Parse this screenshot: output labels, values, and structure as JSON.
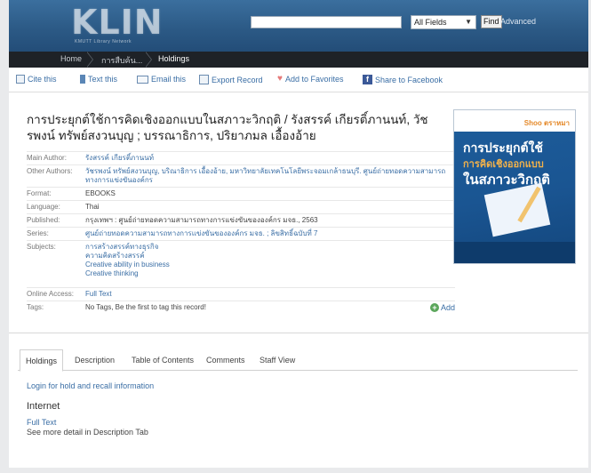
{
  "header": {
    "logo": "KLIN",
    "logo_sub": "KMUTT Library Network",
    "search_placeholder": "",
    "search_type": "All Fields",
    "find_label": "Find",
    "advanced_label": "Advanced"
  },
  "breadcrumb": [
    "Home",
    "การสืบค้น...",
    "Holdings"
  ],
  "toolbar": {
    "cite": "Cite this",
    "text": "Text this",
    "email": "Email this",
    "export": "Export Record",
    "favorites": "Add to Favorites",
    "facebook": "Share to Facebook"
  },
  "record": {
    "title": "การประยุกต์ใช้การคิดเชิงออกแบบในสภาวะวิกฤติ / รังสรรค์ เกียรติ์ภานนท์, วัชรพงน์ ทรัพย์สงวนบุญ ; บรรณาธิการ, ปริยาภมล เอื้องอ้าย",
    "rows": {
      "main_author_label": "Main Author:",
      "main_author": "รังสรรค์ เกียรติ์ภานนท์",
      "other_authors_label": "Other Authors:",
      "other_authors_1": "วัชรพงน์ ทรัพย์สงวนบุญ, บริณาธิการ เอื้องอ้าย, มหาวิทยาลัยเทคโนโลยีพระจอมเกล้าธนบุรี. ศูนย์ถ่ายทอดความสามารถ",
      "other_authors_2": "ทางการแข่งขันองค์กร",
      "format_label": "Format:",
      "format": "EBOOKS",
      "language_label": "Language:",
      "language": "Thai",
      "published_label": "Published:",
      "published": "กรุงเทพฯ : ศูนย์ถ่ายทอดความสามารถทางการแข่งขันขององค์กร มจธ., 2563",
      "series_label": "Series:",
      "series": "ศูนย์ถ่ายทอดความสามารถทางการแข่งขันขององค์กร มจธ. ; ลิขสิทธิ์ฉบับที่ 7",
      "subjects_label": "Subjects:",
      "subjects": [
        "การสร้างสรรค์ทางธุรกิจ",
        "ความคิดสร้างสรรค์",
        "Creative ability in business",
        "Creative thinking"
      ],
      "online_label": "Online Access:",
      "online": "Full Text",
      "tags_label": "Tags:",
      "tags": "No Tags, Be the first to tag this record!",
      "add_label": "Add"
    }
  },
  "cover": {
    "brand": "Shoo ตราหมา",
    "line1": "การประยุกต์ใช้",
    "line2": "การคิดเชิงออกแบบ",
    "line3": "ในสภาวะวิกฤติ"
  },
  "tabs": [
    "Holdings",
    "Description",
    "Table of Contents",
    "Comments",
    "Staff View"
  ],
  "holdings": {
    "login": "Login for hold and recall information",
    "internet": "Internet",
    "full_text": "Full Text",
    "see_more": "See more detail in Description Tab"
  },
  "colors": {
    "header": "#2c5a86",
    "link": "#3a6ea5",
    "crumb_bar": "#1e2227"
  }
}
